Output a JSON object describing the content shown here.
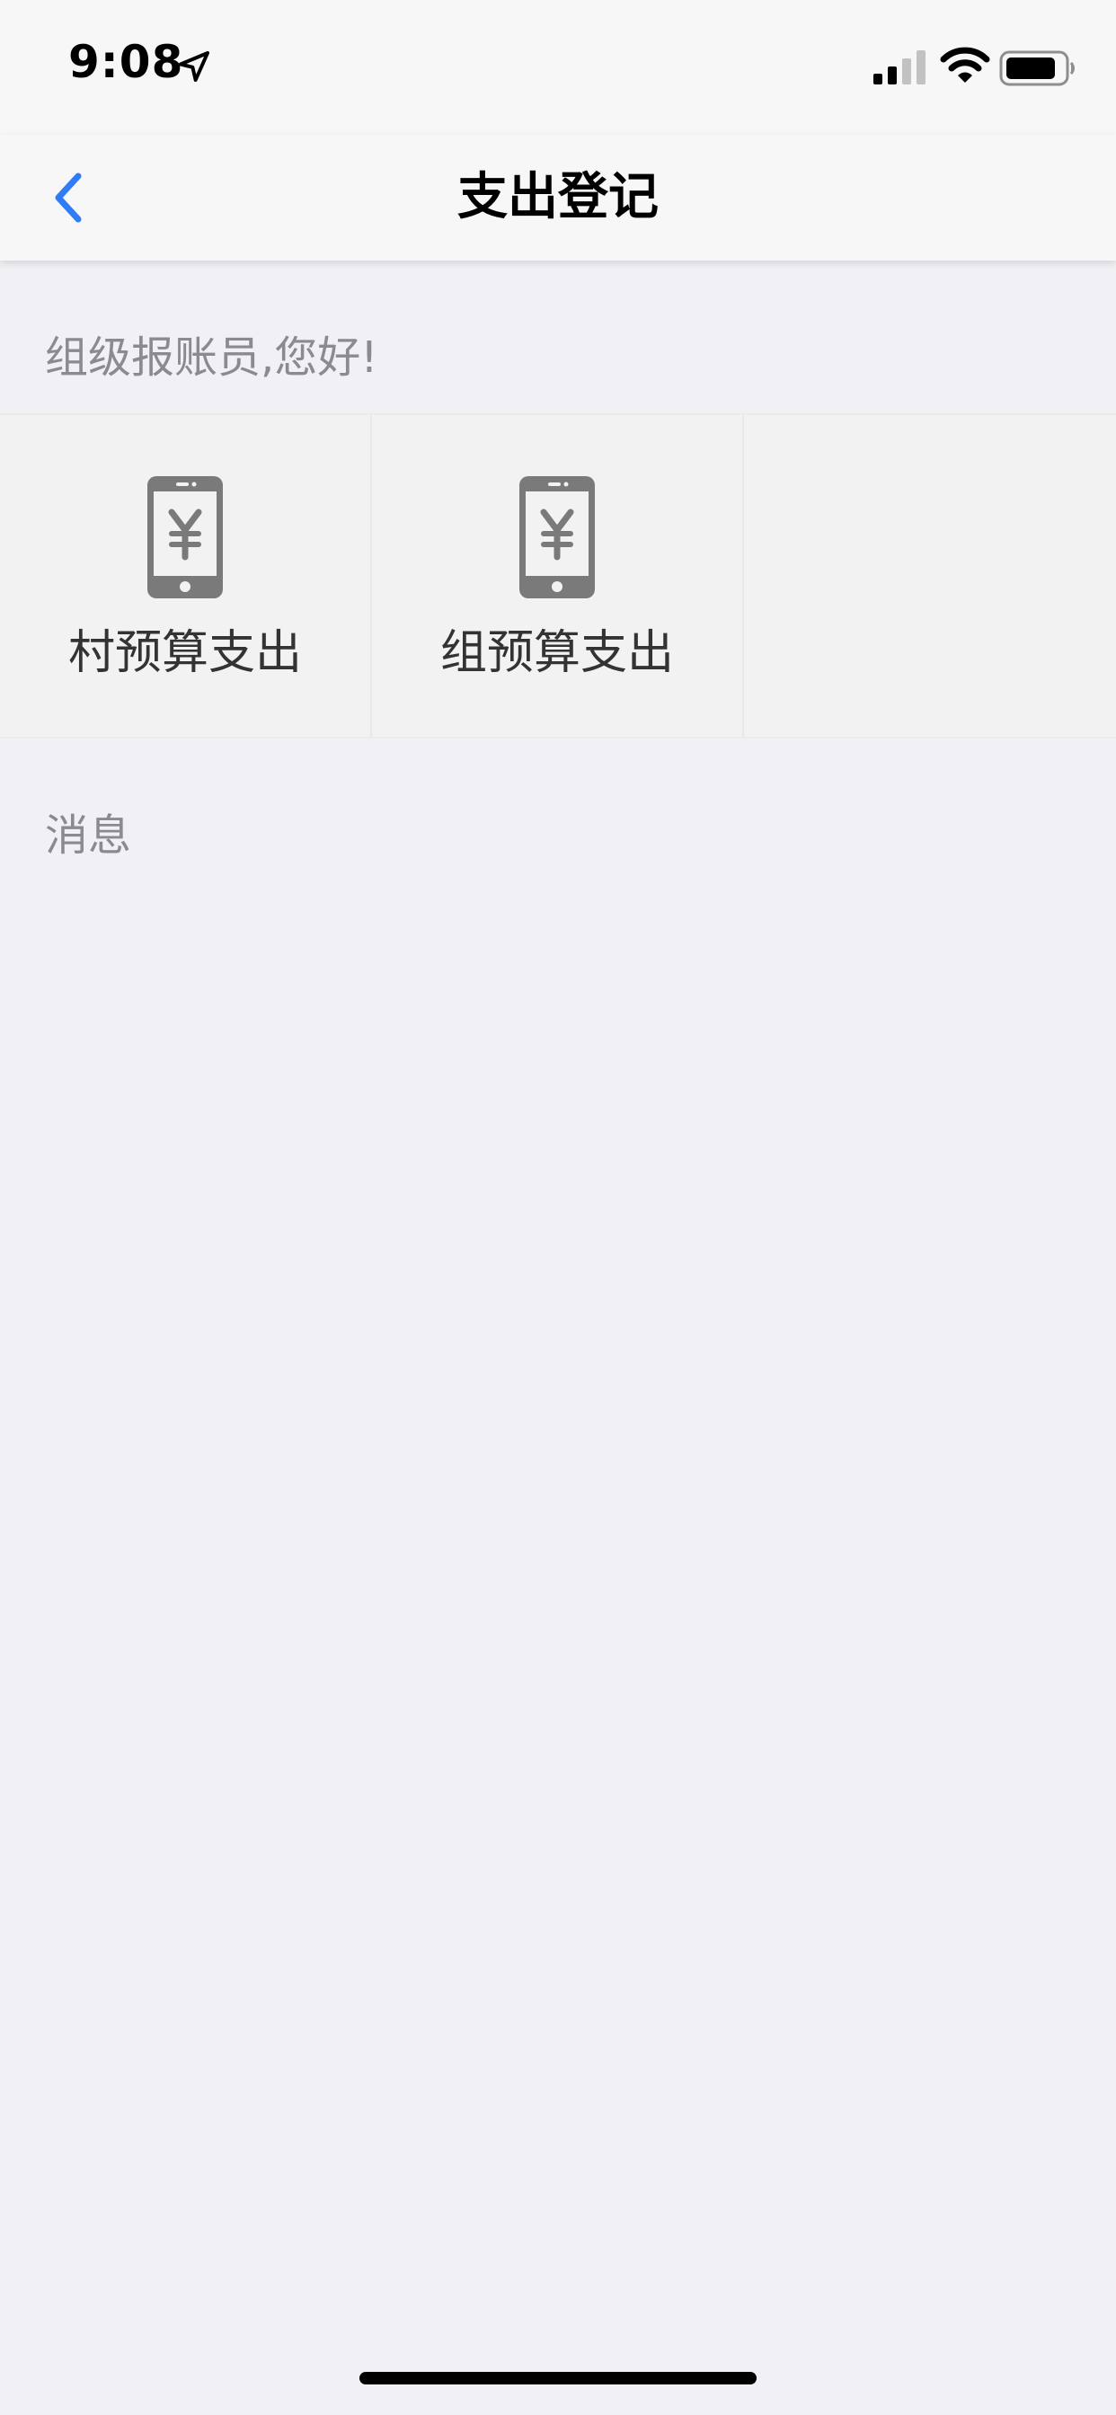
{
  "status_bar": {
    "time": "9:08",
    "icons": [
      "location-icon",
      "signal-icon",
      "wifi-icon",
      "battery-icon"
    ]
  },
  "nav": {
    "title": "支出登记",
    "back_icon": "chevron-left-icon",
    "accent_color": "#2f7cf6"
  },
  "greeting": "组级报账员,您好!",
  "grid": {
    "items": [
      {
        "label": "村预算支出",
        "icon": "phone-yen-icon"
      },
      {
        "label": "组预算支出",
        "icon": "phone-yen-icon"
      }
    ]
  },
  "messages": {
    "title": "消息"
  },
  "colors": {
    "background": "#f0f0f5",
    "bar": "#f7f7f7",
    "icon_gray": "#7a7a7a",
    "muted_text": "#8a8a8f"
  }
}
